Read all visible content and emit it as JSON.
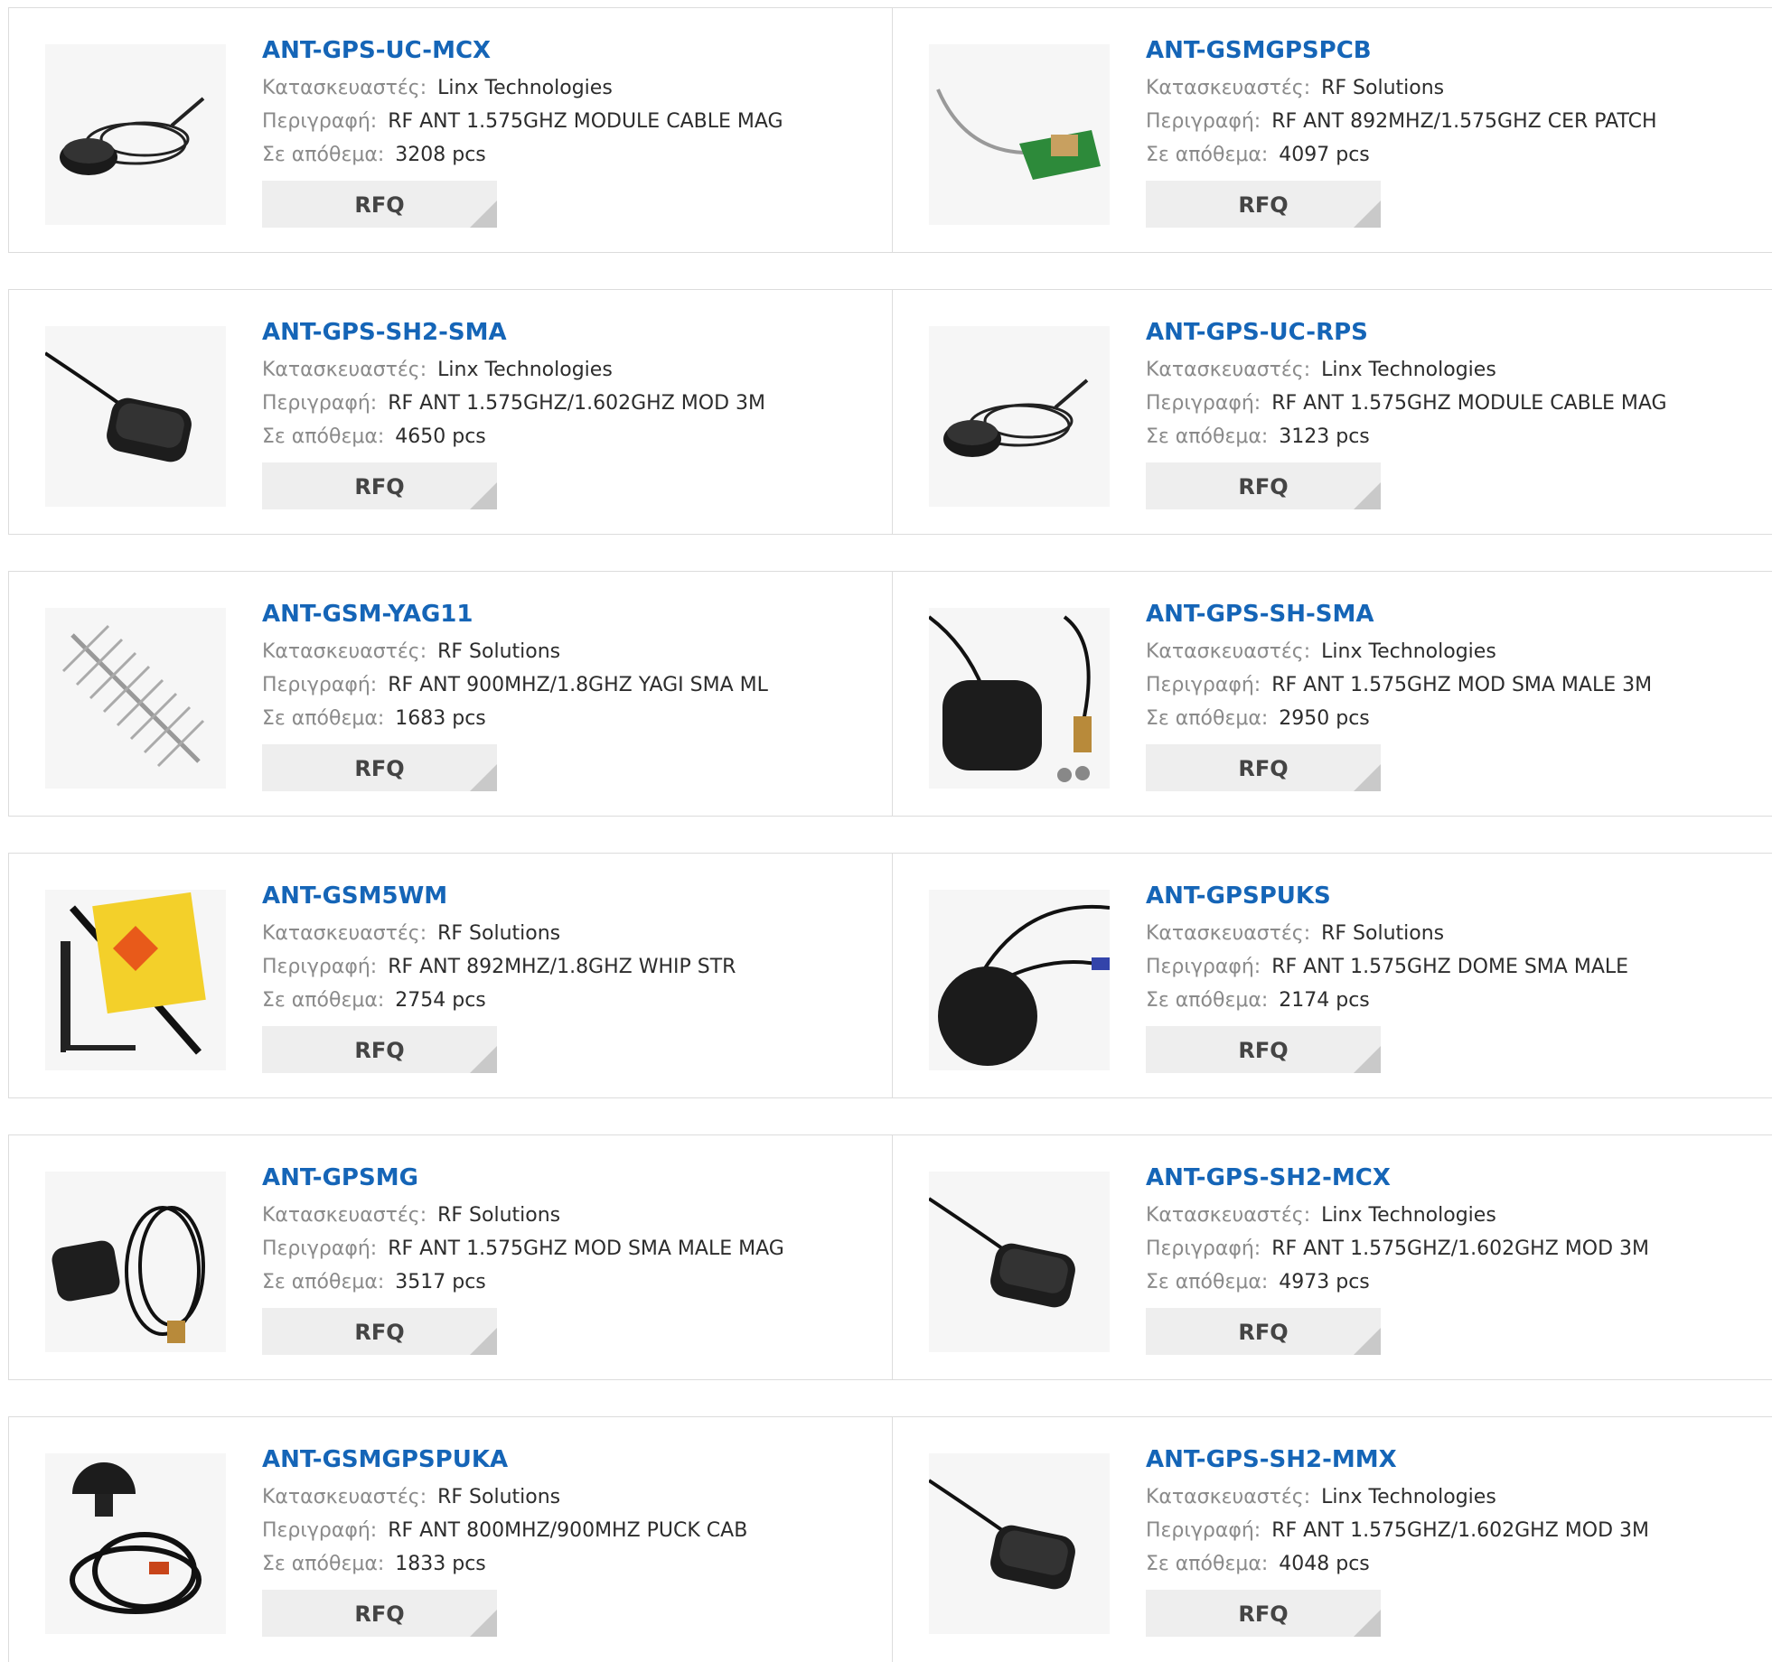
{
  "labels": {
    "manufacturer": "Κατασκευαστές:",
    "description": "Περιγραφή:",
    "stock": "Σε απόθεμα:",
    "rfq": "RFQ"
  },
  "products": [
    {
      "part": "ANT-GPS-UC-MCX",
      "manufacturer": "Linx Technologies",
      "description": "RF ANT 1.575GHZ MODULE CABLE MAG",
      "stock": "3208 pcs",
      "image": "puck-coiled-cable"
    },
    {
      "part": "ANT-GSMGPSPCB",
      "manufacturer": "RF Solutions",
      "description": "RF ANT 892MHZ/1.575GHZ CER PATCH",
      "stock": "4097 pcs",
      "image": "pcb-patch"
    },
    {
      "part": "ANT-GPS-SH2-SMA",
      "manufacturer": "Linx Technologies",
      "description": "RF ANT 1.575GHZ/1.602GHZ MOD 3M",
      "stock": "4650 pcs",
      "image": "puck-square-cable"
    },
    {
      "part": "ANT-GPS-UC-RPS",
      "manufacturer": "Linx Technologies",
      "description": "RF ANT 1.575GHZ MODULE CABLE MAG",
      "stock": "3123 pcs",
      "image": "puck-coiled-cable"
    },
    {
      "part": "ANT-GSM-YAG11",
      "manufacturer": "RF Solutions",
      "description": "RF ANT 900MHZ/1.8GHZ YAGI SMA ML",
      "stock": "1683 pcs",
      "image": "yagi"
    },
    {
      "part": "ANT-GPS-SH-SMA",
      "manufacturer": "Linx Technologies",
      "description": "RF ANT 1.575GHZ MOD SMA MALE 3M",
      "stock": "2950 pcs",
      "image": "puck-sma-connector"
    },
    {
      "part": "ANT-GSM5WM",
      "manufacturer": "RF Solutions",
      "description": "RF ANT 892MHZ/1.8GHZ WHIP STR",
      "stock": "2754 pcs",
      "image": "whip-bracket"
    },
    {
      "part": "ANT-GPSPUKS",
      "manufacturer": "RF Solutions",
      "description": "RF ANT 1.575GHZ DOME SMA MALE",
      "stock": "2174 pcs",
      "image": "round-puck"
    },
    {
      "part": "ANT-GPSMG",
      "manufacturer": "RF Solutions",
      "description": "RF ANT 1.575GHZ MOD SMA MALE MAG",
      "stock": "3517 pcs",
      "image": "puck-long-cable"
    },
    {
      "part": "ANT-GPS-SH2-MCX",
      "manufacturer": "Linx Technologies",
      "description": "RF ANT 1.575GHZ/1.602GHZ MOD 3M",
      "stock": "4973 pcs",
      "image": "puck-square-cable"
    },
    {
      "part": "ANT-GSMGPSPUKA",
      "manufacturer": "RF Solutions",
      "description": "RF ANT 800MHZ/900MHZ PUCK CAB",
      "stock": "1833 pcs",
      "image": "dome-coiled-cable"
    },
    {
      "part": "ANT-GPS-SH2-MMX",
      "manufacturer": "Linx Technologies",
      "description": "RF ANT 1.575GHZ/1.602GHZ MOD 3M",
      "stock": "4048 pcs",
      "image": "puck-square-cable"
    }
  ]
}
